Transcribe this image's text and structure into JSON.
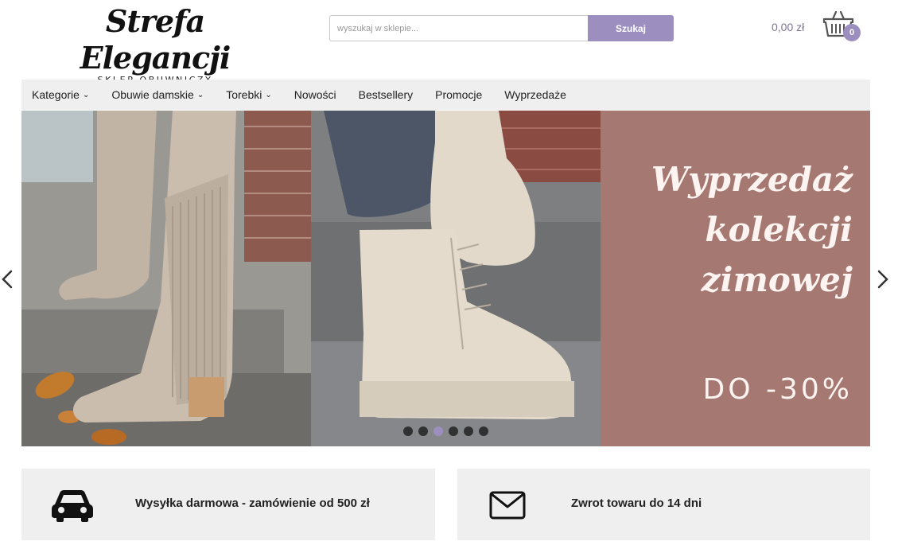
{
  "logo": {
    "title": "Strefa Elegancji",
    "subtitle": "SKLEP OBUWNICZY"
  },
  "search": {
    "placeholder": "wyszukaj w sklepie...",
    "button_label": "Szukaj"
  },
  "cart": {
    "total": "0,00 zł",
    "count": "0",
    "icon": "basket-icon"
  },
  "nav": {
    "items": [
      {
        "label": "Kategorie",
        "dropdown": true
      },
      {
        "label": "Obuwie damskie",
        "dropdown": true
      },
      {
        "label": "Torebki",
        "dropdown": true
      },
      {
        "label": "Nowości",
        "dropdown": false
      },
      {
        "label": "Bestsellery",
        "dropdown": false
      },
      {
        "label": "Promocje",
        "dropdown": false
      },
      {
        "label": "Wyprzedaże",
        "dropdown": false
      }
    ]
  },
  "banner": {
    "line1": "Wyprzedaż",
    "line2": "kolekcji",
    "line3": "zimowej",
    "discount": "DO -30%",
    "slide_count": 6,
    "active_slide": 3,
    "panel_color": "#a67872"
  },
  "features": [
    {
      "icon": "car-icon",
      "text": "Wysyłka darmowa - zamówienie od 500 zł"
    },
    {
      "icon": "envelope-icon",
      "text": "Zwrot towaru do 14 dni"
    }
  ],
  "colors": {
    "accent": "#9c8fc0",
    "nav_bg": "#efefef",
    "price_text": "#7d7593"
  }
}
